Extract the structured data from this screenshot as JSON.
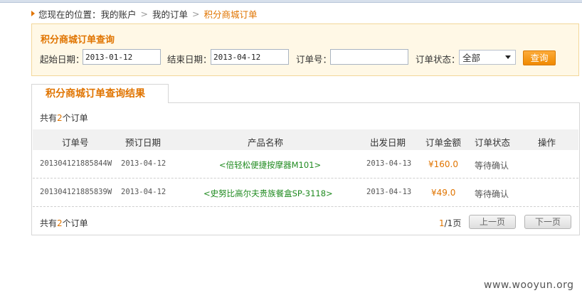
{
  "breadcrumb": {
    "prefix": "您现在的位置：",
    "items": [
      "我的账户",
      "我的订单",
      "积分商城订单"
    ],
    "separator": ">"
  },
  "query": {
    "title": "积分商城订单查询",
    "start_label": "起始日期：",
    "start_value": "2013-01-12",
    "end_label": "结束日期：",
    "end_value": "2013-04-12",
    "order_no_label": "订单号：",
    "order_no_value": "",
    "status_label": "订单状态：",
    "status_value": "全部",
    "search_button": "查询"
  },
  "results": {
    "tab_label": "积分商城订单查询结果",
    "count_prefix": "共有",
    "count": "2",
    "count_suffix": "个订单",
    "columns": [
      "订单号",
      "预订日期",
      "产品名称",
      "出发日期",
      "订单金额",
      "订单状态",
      "操作"
    ],
    "rows": [
      {
        "order_no": "201304121885844W",
        "book_date": "2013-04-12",
        "product": "<倍轻松便捷按摩器M101>",
        "depart_date": "2013-04-13",
        "amount": "¥160.0",
        "status": "等待确认",
        "action": ""
      },
      {
        "order_no": "201304121885839W",
        "book_date": "2013-04-12",
        "product": "<史努比高尔夫贵族餐盒SP-3118>",
        "depart_date": "2013-04-13",
        "amount": "¥49.0",
        "status": "等待确认",
        "action": ""
      }
    ]
  },
  "pagination": {
    "current": "1",
    "total": "/1页",
    "prev": "上一页",
    "next": "下一页"
  },
  "watermark": "www.wooyun.org",
  "colors": {
    "accent": "#e07400",
    "product_link": "#1f8a1f",
    "query_bg": "#fff8e6"
  }
}
